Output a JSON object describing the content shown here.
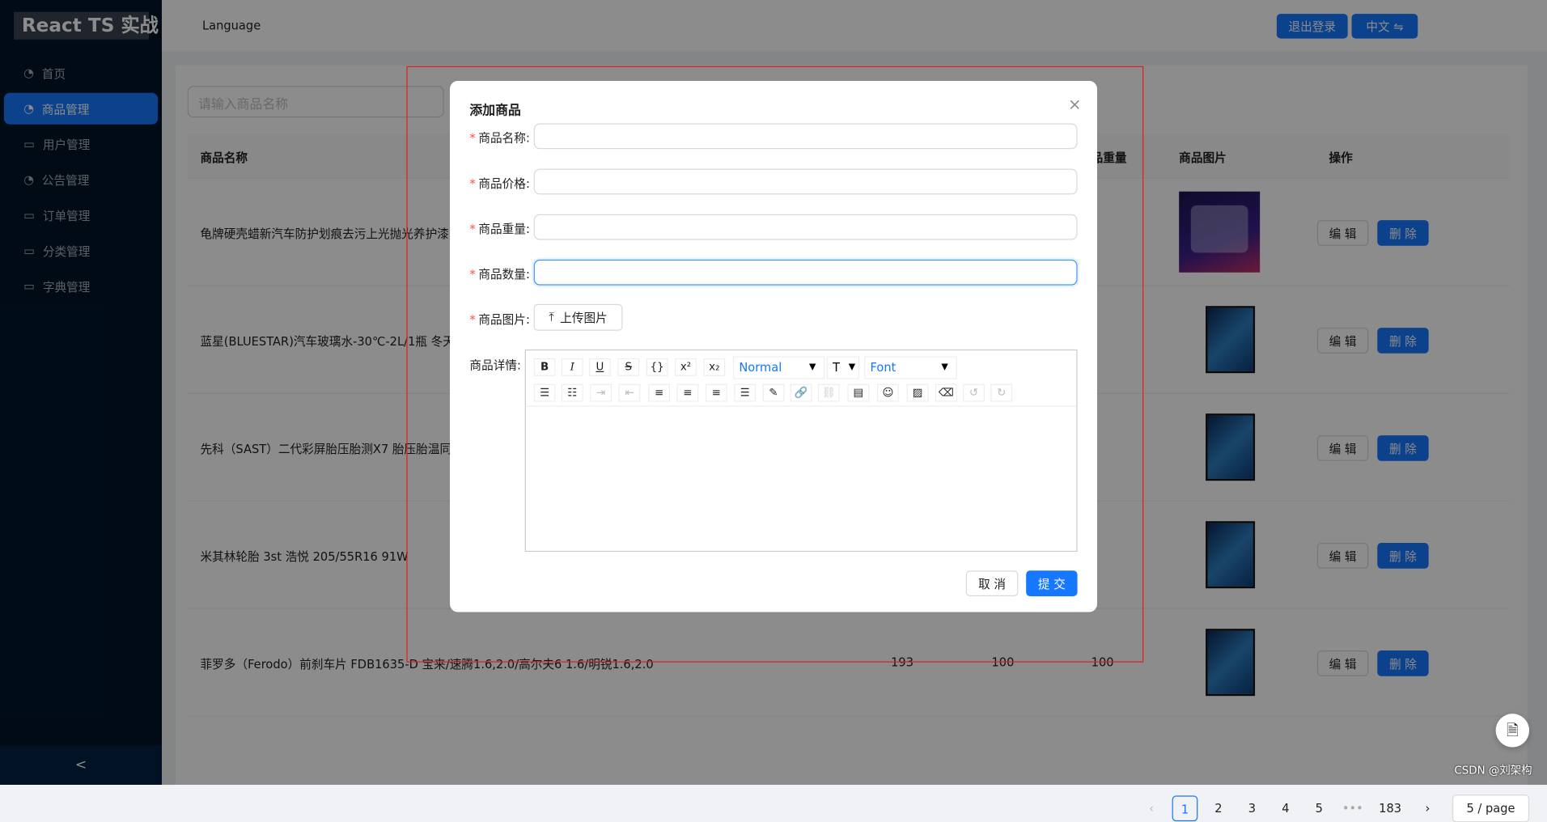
{
  "app": {
    "title": "React TS 实战"
  },
  "sidebar": {
    "items": [
      {
        "label": "首页",
        "icon": "pie-chart-icon"
      },
      {
        "label": "商品管理",
        "icon": "pie-chart-icon",
        "active": true
      },
      {
        "label": "用户管理",
        "icon": "desktop-icon"
      },
      {
        "label": "公告管理",
        "icon": "pie-chart-icon"
      },
      {
        "label": "订单管理",
        "icon": "desktop-icon"
      },
      {
        "label": "分类管理",
        "icon": "desktop-icon"
      },
      {
        "label": "字典管理",
        "icon": "desktop-icon"
      }
    ],
    "collapse": "<"
  },
  "header": {
    "language": "Language",
    "logout": "退出登录",
    "lang_switch": "中文 ⇋"
  },
  "search": {
    "placeholder": "请输入商品名称"
  },
  "table": {
    "columns": [
      "商品名称",
      "商品重量",
      "商品图片",
      "操作"
    ],
    "rows": [
      {
        "name": "龟牌硬壳蜡新汽车防护划痕去污上光抛光养护漆固"
      },
      {
        "name": "蓝星(BLUESTAR)汽车玻璃水-30℃-2L/1瓶 冬天防冻"
      },
      {
        "name": "先科（SAST）二代彩屏胎压胎测X7 胎压胎温同显"
      },
      {
        "name": "米其林轮胎 3st 浩悦 205/55R16 91W"
      },
      {
        "name": "菲罗多（Ferodo）前刹车片 FDB1635-D 宝来/速腾1.6,2.0/高尔夫6 1.6/明锐1.6,2.0",
        "price": "193",
        "weight": "100",
        "count": "100"
      }
    ],
    "edit": "编 辑",
    "delete": "删 除"
  },
  "pagination": {
    "prev": "‹",
    "pages": [
      "1",
      "2",
      "3",
      "4",
      "5",
      "•••",
      "183"
    ],
    "current": "1",
    "next": "›",
    "page_size": "5 / page"
  },
  "modal": {
    "title": "添加商品",
    "close": "×",
    "fields": [
      {
        "label": "商品名称:",
        "value": ""
      },
      {
        "label": "商品价格:",
        "value": ""
      },
      {
        "label": "商品重量:",
        "value": ""
      },
      {
        "label": "商品数量:",
        "value": "",
        "focused": true
      }
    ],
    "image_label": "商品图片:",
    "upload": "上传图片",
    "detail_label": "商品详情:",
    "editor": {
      "header": "Normal",
      "font": "Font"
    },
    "cancel": "取 消",
    "submit": "提 交"
  },
  "watermark": "CSDN @刘架构",
  "colors": {
    "primary": "#1677ff",
    "sidebar": "#001529",
    "required": "#ff4d4f"
  }
}
